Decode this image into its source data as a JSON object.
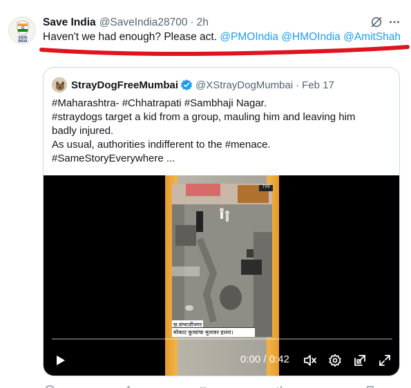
{
  "tweet": {
    "author_name": "Save India",
    "author_handle": "@SaveIndia28700",
    "separator": "·",
    "time": "2h",
    "text": "Haven't we had enough? Please act.",
    "mentions": [
      "@PMOIndia",
      "@HMOIndia",
      "@AmitShah"
    ],
    "avatar_text": "SAVE INDIA"
  },
  "quote": {
    "author_name": "StrayDogFreeMumbai",
    "author_handle": "@XStrayDogMumbai",
    "separator": "·",
    "time": "Feb 17",
    "lines": [
      "#Maharashtra- #Chhatrapati #Sambhaji Nagar.",
      "#straydogs target a kid from a group, mauling him and leaving him",
      "badly injured.",
      "As usual, authorities indifferent to the #menace.",
      "#SameStoryEverywhere ..."
    ]
  },
  "video": {
    "time_display": "0:00 / 0:42",
    "caption_place": "छ.संभाजीनगर",
    "caption_headline": "मोकाट कुत्र्यांचा मुलावर हल्ला।",
    "channel_logo": "TV9",
    "progress": 0
  },
  "colors": {
    "accent": "#1d9bf0",
    "underline": "#e0141e",
    "muted": "#536471"
  },
  "icons": [
    "grok-icon",
    "more-icon",
    "verified-badge-icon",
    "play-icon",
    "mute-icon",
    "settings-icon",
    "popout-icon",
    "fullscreen-icon"
  ]
}
